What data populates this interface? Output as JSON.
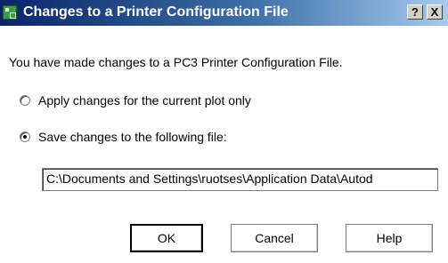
{
  "window": {
    "title": "Changes to a Printer Configuration File",
    "help_button": "?",
    "close_button": "X"
  },
  "message": "You have made changes to a PC3 Printer Configuration File.",
  "options": [
    {
      "label": "Apply changes for the current plot only",
      "checked": false
    },
    {
      "label": "Save changes to the following file:",
      "checked": true
    }
  ],
  "file_path": "C:\\Documents and Settings\\ruotses\\Application Data\\Autod",
  "buttons": {
    "ok": "OK",
    "cancel": "Cancel",
    "help": "Help"
  }
}
